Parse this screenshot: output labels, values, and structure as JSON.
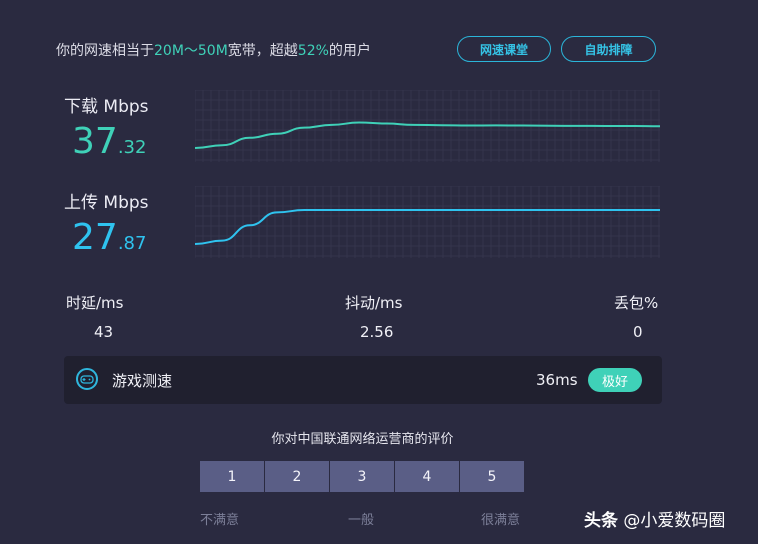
{
  "summary": {
    "prefix": "你的网速相当于",
    "bandwidth": "20M～50M",
    "mid": "宽带，超越",
    "percent": "52%",
    "suffix": "的用户"
  },
  "buttons": {
    "course": "网速课堂",
    "diagnose": "自助排障"
  },
  "download": {
    "label": "下载 Mbps",
    "int": "37",
    "dec": ".32",
    "color": "#3fd1b8",
    "curve": [
      0.0,
      0.08,
      0.3,
      0.42,
      0.6,
      0.68,
      0.75,
      0.72,
      0.68,
      0.67,
      0.66,
      0.665,
      0.66,
      0.655,
      0.65,
      0.648,
      0.646,
      0.64
    ]
  },
  "upload": {
    "label": "上传 Mbps",
    "int": "27",
    "dec": ".87",
    "color": "#2fc3ef",
    "curve": [
      0.0,
      0.1,
      0.55,
      0.93,
      1.0,
      1.0,
      1.0,
      1.0,
      1.0,
      1.0,
      1.0,
      1.0,
      1.0,
      1.0,
      1.0,
      1.0,
      1.0,
      1.0
    ]
  },
  "stats": {
    "latency_label": "时延/ms",
    "latency_value": "43",
    "jitter_label": "抖动/ms",
    "jitter_value": "2.56",
    "loss_label": "丢包%",
    "loss_value": "0"
  },
  "game": {
    "title": "游戏测速",
    "ping": "36ms",
    "badge": "极好"
  },
  "rating": {
    "title": "你对中国联通网络运营商的评价",
    "options": [
      "1",
      "2",
      "3",
      "4",
      "5"
    ],
    "low": "不满意",
    "mid": "一般",
    "high": "很满意"
  },
  "watermark": {
    "source": "头条",
    "author": "@小爱数码圈"
  }
}
